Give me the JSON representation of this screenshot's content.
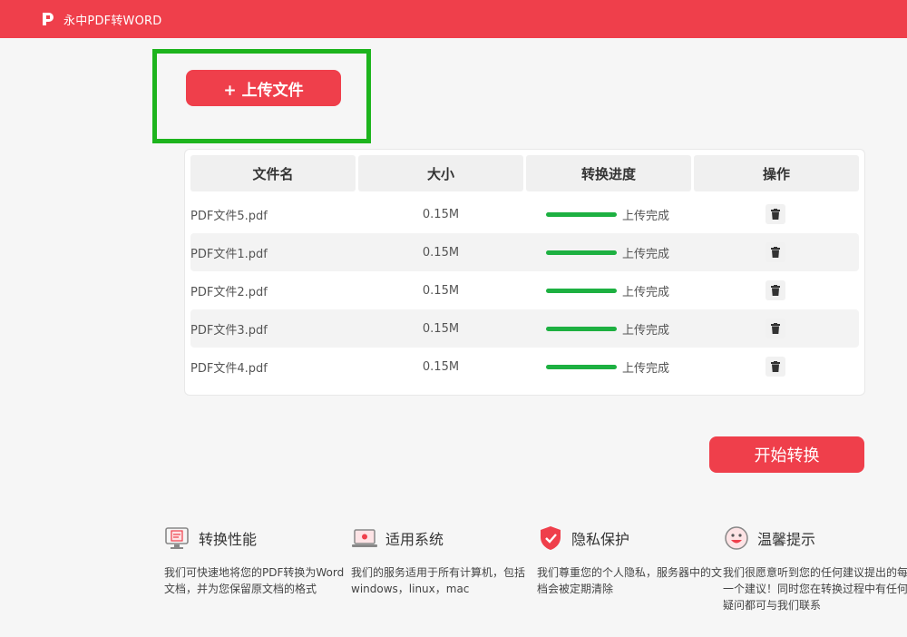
{
  "header": {
    "app_title": "永中PDF转WORD"
  },
  "upload": {
    "label": "+ 上传文件"
  },
  "table": {
    "columns": [
      "文件名",
      "大小",
      "转换进度",
      "操作"
    ],
    "rows": [
      {
        "name": "PDF文件5.pdf",
        "size": "0.15M",
        "progress": 1.0,
        "status": "上传完成"
      },
      {
        "name": "PDF文件1.pdf",
        "size": "0.15M",
        "progress": 1.0,
        "status": "上传完成"
      },
      {
        "name": "PDF文件2.pdf",
        "size": "0.15M",
        "progress": 1.0,
        "status": "上传完成"
      },
      {
        "name": "PDF文件3.pdf",
        "size": "0.15M",
        "progress": 1.0,
        "status": "上传完成"
      },
      {
        "name": "PDF文件4.pdf",
        "size": "0.15M",
        "progress": 1.0,
        "status": "上传完成"
      }
    ]
  },
  "actions": {
    "start_label": "开始转换"
  },
  "features": [
    {
      "title": "转换性能",
      "icon": "monitor-doc-icon",
      "desc": "我们可快速地将您的PDF转换为Word文档，并为您保留原文档的格式"
    },
    {
      "title": "适用系统",
      "icon": "laptop-icon",
      "desc": "我们的服务适用于所有计算机，包括windows，linux，mac"
    },
    {
      "title": "隐私保护",
      "icon": "shield-icon",
      "desc": "我们尊重您的个人隐私，服务器中的文档会被定期清除"
    },
    {
      "title": "温馨提示",
      "icon": "smile-icon",
      "desc": "我们很愿意听到您的任何建议提出的每一个建议！同时您在转换过程中有任何疑问都可与我们联系"
    }
  ],
  "colors": {
    "brand": "#ef3f4b",
    "progress": "#1db041",
    "highlight": "#1db41d"
  }
}
